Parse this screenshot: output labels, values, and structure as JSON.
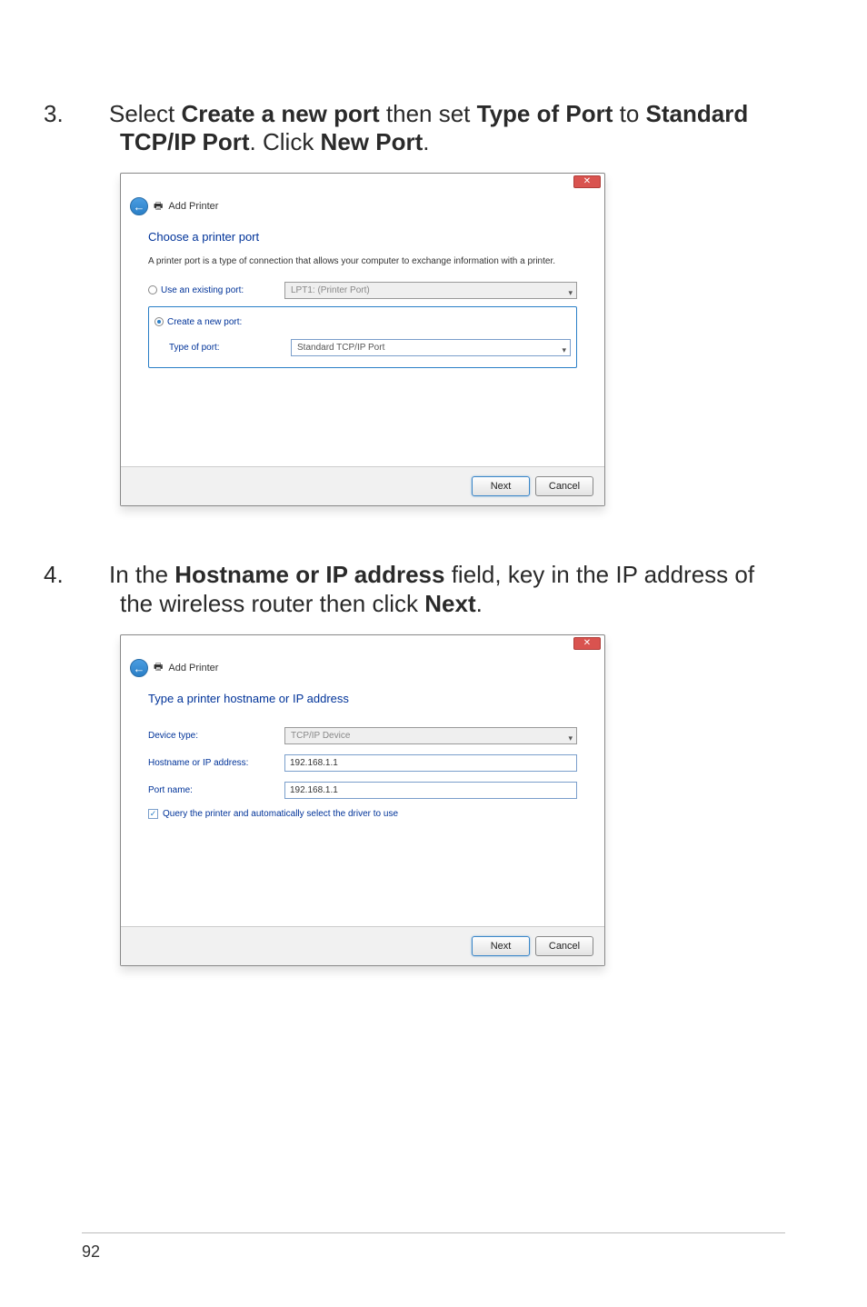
{
  "page_number": "92",
  "steps": [
    {
      "num": "3.",
      "segments": [
        {
          "text": "Select ",
          "bold": false
        },
        {
          "text": "Create a new port",
          "bold": true
        },
        {
          "text": " then set ",
          "bold": false
        },
        {
          "text": "Type of Port",
          "bold": true
        },
        {
          "text": " to ",
          "bold": false
        },
        {
          "text": "Standard TCP/IP Port",
          "bold": true
        },
        {
          "text": ". Click ",
          "bold": false
        },
        {
          "text": "New Port",
          "bold": true
        },
        {
          "text": ".",
          "bold": false
        }
      ]
    },
    {
      "num": "4.",
      "segments": [
        {
          "text": "In the ",
          "bold": false
        },
        {
          "text": "Hostname or IP address",
          "bold": true
        },
        {
          "text": " field, key in the IP address of the wireless router then click ",
          "bold": false
        },
        {
          "text": "Next",
          "bold": true
        },
        {
          "text": ".",
          "bold": false
        }
      ]
    }
  ],
  "dialog1": {
    "title": "Add Printer",
    "heading": "Choose a printer port",
    "desc": "A printer port is a type of connection that allows your computer to exchange information with a printer.",
    "use_existing_label": "Use an existing port:",
    "use_existing_value": "LPT1: (Printer Port)",
    "create_new_label": "Create a new port:",
    "type_of_port_label": "Type of port:",
    "type_of_port_value": "Standard TCP/IP Port",
    "next": "Next",
    "cancel": "Cancel"
  },
  "dialog2": {
    "title": "Add Printer",
    "heading": "Type a printer hostname or IP address",
    "device_type_label": "Device type:",
    "device_type_value": "TCP/IP Device",
    "hostname_label": "Hostname or IP address:",
    "hostname_value": "192.168.1.1",
    "portname_label": "Port name:",
    "portname_value": "192.168.1.1",
    "query_label": "Query the printer and automatically select the driver to use",
    "next": "Next",
    "cancel": "Cancel"
  }
}
